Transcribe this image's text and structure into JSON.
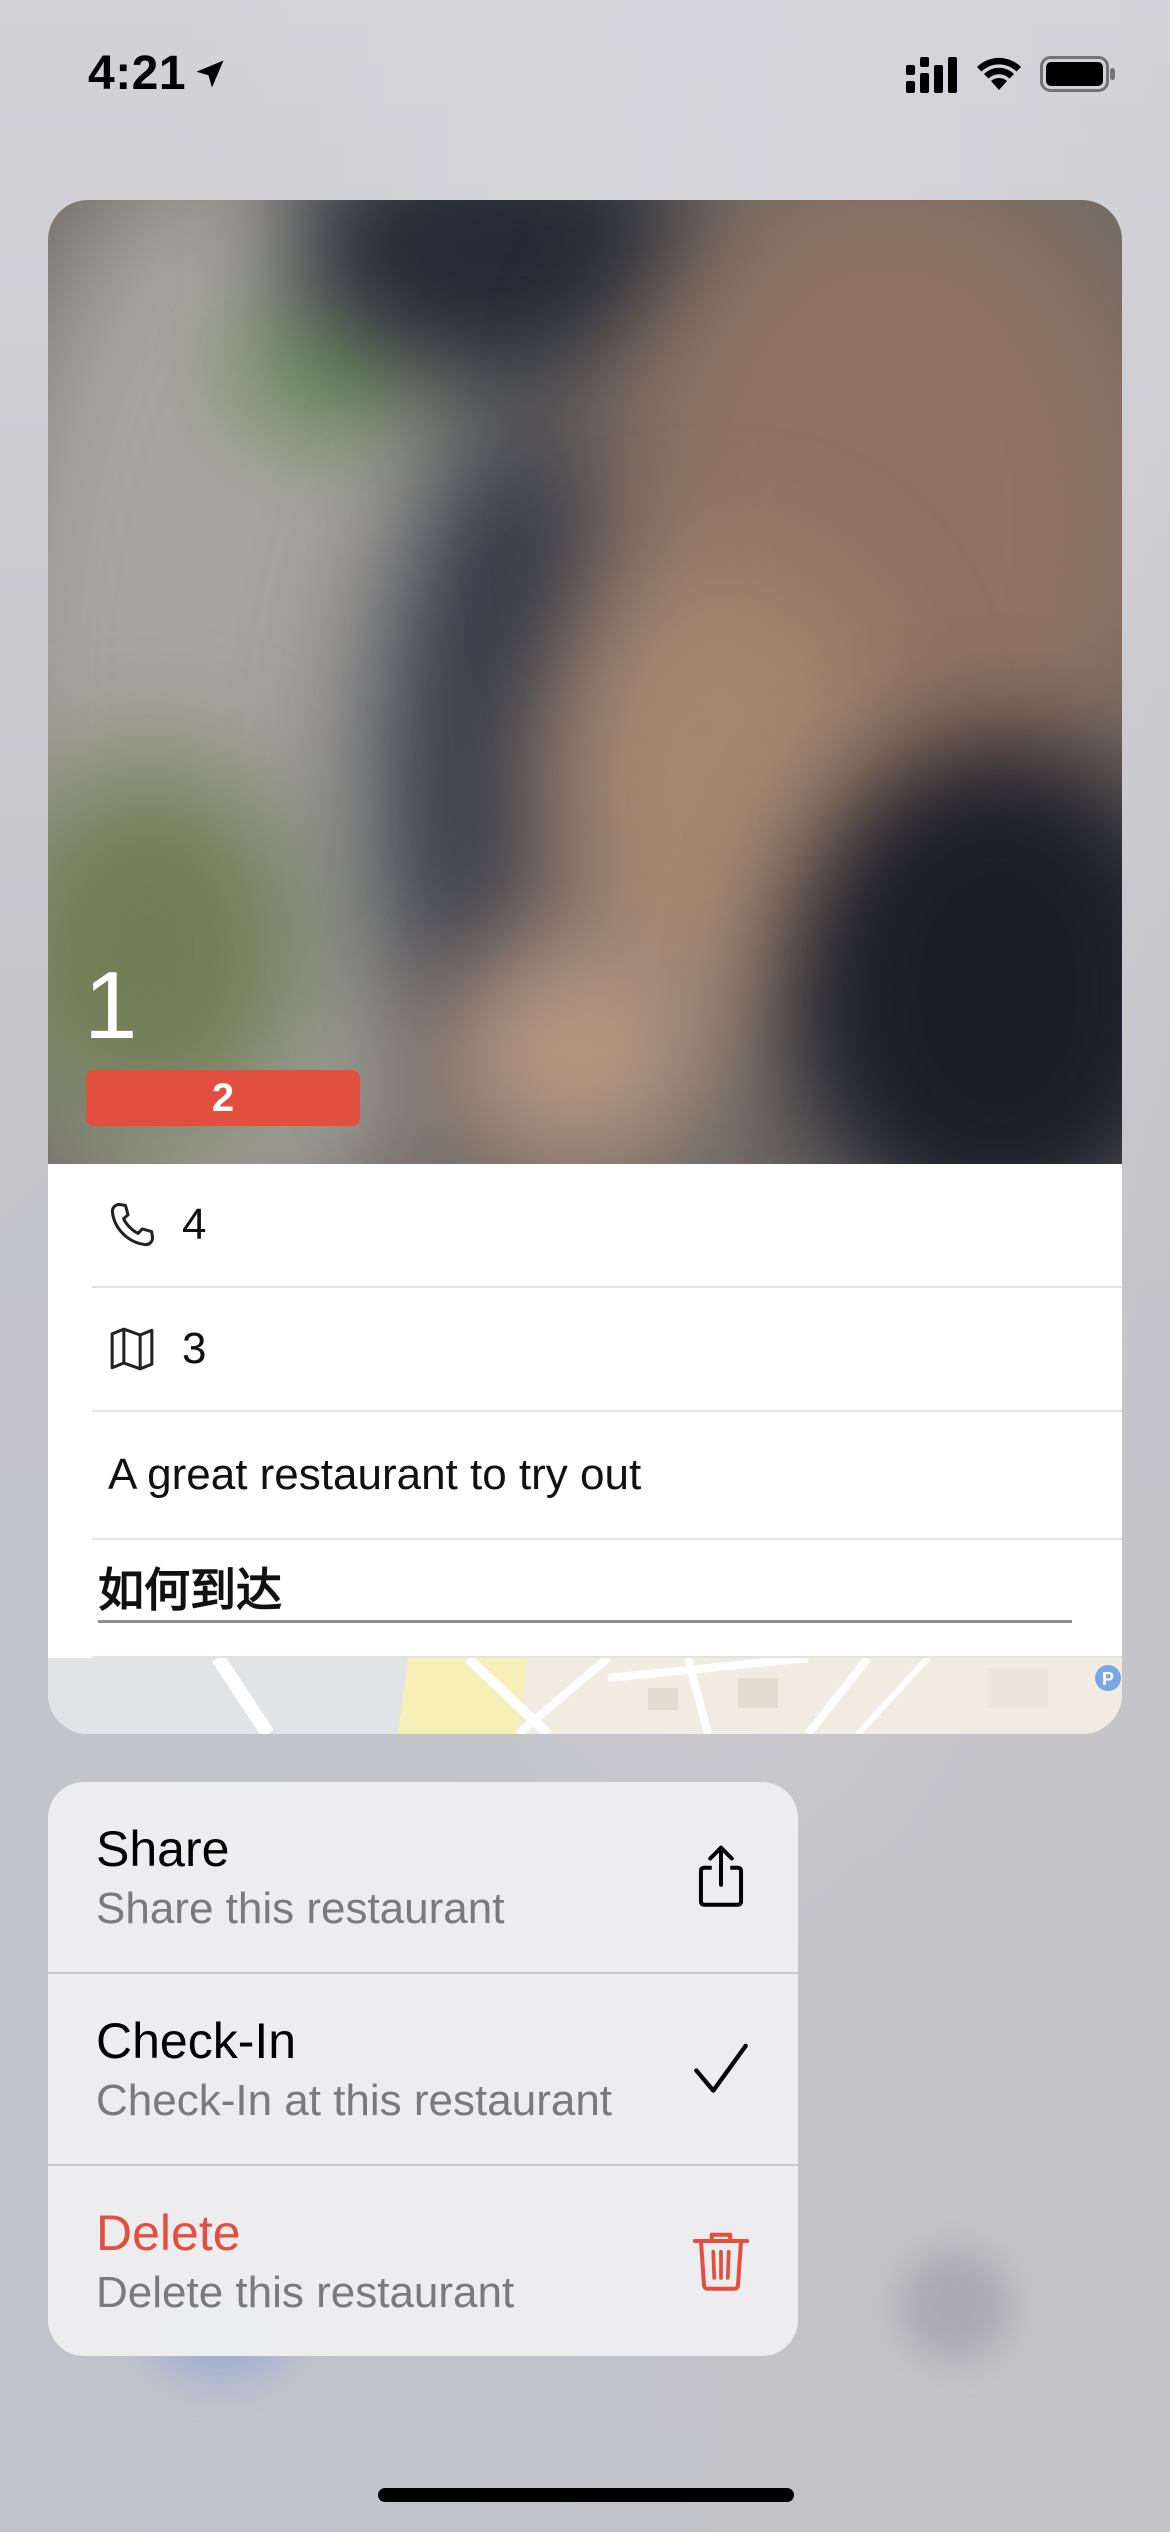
{
  "status_bar": {
    "time": "4:21"
  },
  "preview": {
    "title": "1",
    "badge": "2",
    "phone": "4",
    "address": "3",
    "description": "A great restaurant to try out",
    "directions_heading": "如何到达"
  },
  "menu": {
    "items": [
      {
        "title": "Share",
        "subtitle": "Share this restaurant",
        "icon": "share-icon"
      },
      {
        "title": "Check-In",
        "subtitle": "Check-In at this restaurant",
        "icon": "checkmark-icon"
      },
      {
        "title": "Delete",
        "subtitle": "Delete this restaurant",
        "icon": "trash-icon",
        "destructive": true
      }
    ]
  },
  "colors": {
    "destructive": "#e34f3f",
    "badge": "#e34f3f",
    "secondary_text": "#7a7a7e"
  }
}
